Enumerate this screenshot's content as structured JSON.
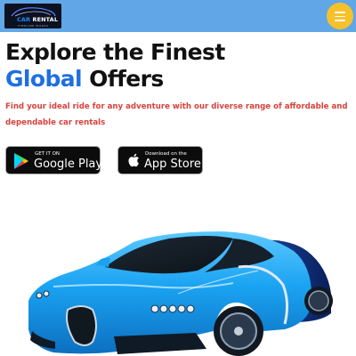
{
  "header": {
    "logo": {
      "brand": "CAR RENTAL",
      "brand_part1": "CAR",
      "brand_part2": " RENTAL",
      "tagline": "TIMELINE WORKS"
    },
    "menu_icon": "hamburger-menu-icon",
    "colors": {
      "bar": "#61a6e6",
      "menu_button": "#f7c12c"
    }
  },
  "hero": {
    "heading_line1": "Explore the Finest",
    "heading_accent": "Global",
    "heading_rest": " Offers",
    "subtext": "Find your ideal ride for any adventure with our diverse range of affordable and dependable car rentals",
    "colors": {
      "accent": "#1f6fe0",
      "subtext": "#d9403a"
    }
  },
  "store_badges": [
    {
      "store": "google-play",
      "small": "GET IT ON",
      "big": "Google Play",
      "icon": "google-play-icon"
    },
    {
      "store": "app-store",
      "small": "Download on the",
      "big": "App Store",
      "icon": "apple-icon"
    }
  ],
  "car": {
    "icon": "sports-car-image",
    "body_color": "#1aa3f2"
  }
}
